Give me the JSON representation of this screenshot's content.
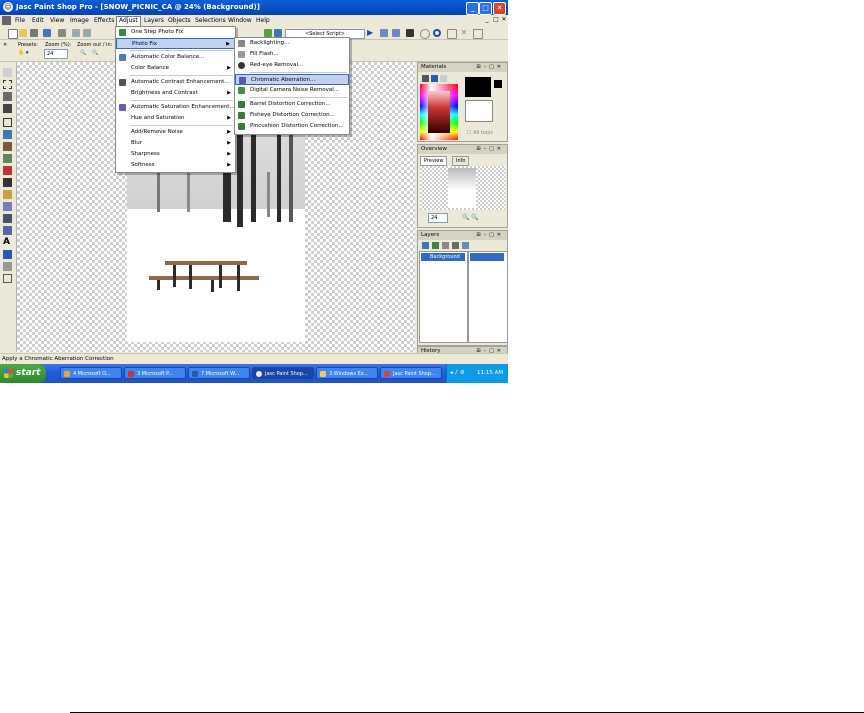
{
  "window": {
    "title": "Jasc Paint Shop Pro - [SNOW_PICNIC_CA @ 24% (Background)]",
    "menus": [
      "File",
      "Edit",
      "View",
      "Image",
      "Effects",
      "Adjust",
      "Layers",
      "Objects",
      "Selections",
      "Window",
      "Help"
    ],
    "active_menu": "Adjust"
  },
  "toolbar": {
    "script_select": "<Select Script>"
  },
  "options": {
    "presets_label": "Presets:",
    "zoom_pct_label": "Zoom (%):",
    "zoom_out_label": "Zoom out / in:",
    "zoom_value": "24"
  },
  "adjust_menu": [
    {
      "label": "One Step Photo Fix",
      "icon": "one-step-photo-fix-icon"
    },
    {
      "label": "Photo Fix",
      "icon": "",
      "arrow": true,
      "highlight": true
    },
    {
      "label": "Automatic Color Balance...",
      "icon": "color-balance-icon"
    },
    {
      "label": "Color Balance",
      "icon": "",
      "arrow": true
    },
    {
      "label": "Automatic Contrast Enhancement...",
      "icon": "contrast-icon"
    },
    {
      "label": "Brightness and Contrast",
      "icon": "",
      "arrow": true
    },
    {
      "label": "Automatic Saturation Enhancement...",
      "icon": "saturation-icon"
    },
    {
      "label": "Hue and Saturation",
      "icon": "",
      "arrow": true
    },
    {
      "label": "Add/Remove Noise",
      "icon": "",
      "arrow": true
    },
    {
      "label": "Blur",
      "icon": "",
      "arrow": true
    },
    {
      "label": "Sharpness",
      "icon": "",
      "arrow": true
    },
    {
      "label": "Softness",
      "icon": "",
      "arrow": true
    }
  ],
  "photofix_menu": [
    {
      "label": "Backlighting...",
      "icon": "backlighting-icon"
    },
    {
      "label": "Fill Flash...",
      "icon": "fill-flash-icon"
    },
    {
      "label": "Red-eye Removal...",
      "icon": "red-eye-icon"
    },
    {
      "label": "Chromatic Aberration...",
      "icon": "chromatic-aberration-icon",
      "highlight": true
    },
    {
      "label": "Digital Camera Noise Removal...",
      "icon": "noise-removal-icon"
    },
    {
      "label": "Barrel Distortion Correction...",
      "icon": "barrel-distortion-icon"
    },
    {
      "label": "Fisheye Distortion Correction...",
      "icon": "fisheye-icon"
    },
    {
      "label": "Pincushion Distortion Correction...",
      "icon": "pincushion-icon"
    }
  ],
  "panels": {
    "materials": "Materials",
    "all_tools": "All tools",
    "overview": "Overview",
    "overview_tabs": [
      "Preview",
      "Info"
    ],
    "overview_zoom": "24",
    "layers": "Layers",
    "layer_name": "Background",
    "history": "History"
  },
  "status": "Apply a Chromatic Aberration Correction",
  "taskbar": {
    "start": "start",
    "tasks": [
      "4 Microsoft O...",
      "3 Microsoft P...",
      "7 Microsoft W...",
      "Jasc Paint Shop...",
      "3 Windows Ex...",
      "Jasc Paint Shop..."
    ],
    "time": "11:15 AM"
  }
}
